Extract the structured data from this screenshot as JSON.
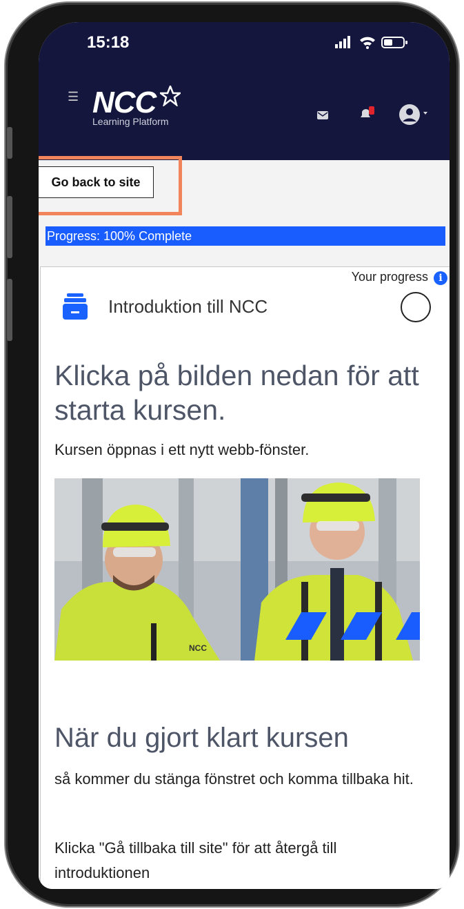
{
  "status": {
    "time": "15:18"
  },
  "header": {
    "logo_text": "NCC",
    "logo_sub": "Learning Platform"
  },
  "nav": {
    "back_label": "Go back to site"
  },
  "progress": {
    "label": "Progress: 100% Complete",
    "value": 100
  },
  "activity": {
    "your_progress_label": "Your progress",
    "info_glyph": "i",
    "title": "Introduktion till NCC"
  },
  "content": {
    "heading": "Klicka på bilden nedan för att starta kursen.",
    "lead": "Kursen öppnas i ett nytt webb-fönster.",
    "image_logo": "NCC",
    "heading2": "När du gjort klart kursen",
    "para1": "så kommer du stänga fönstret och komma tillbaka hit.",
    "para2": "Klicka \"Gå tillbaka till site\" för att återgå till introduktionen"
  },
  "colors": {
    "navy": "#14163d",
    "progress": "#1a5dff",
    "highlight": "#f2845c",
    "heading": "#4d5567"
  }
}
